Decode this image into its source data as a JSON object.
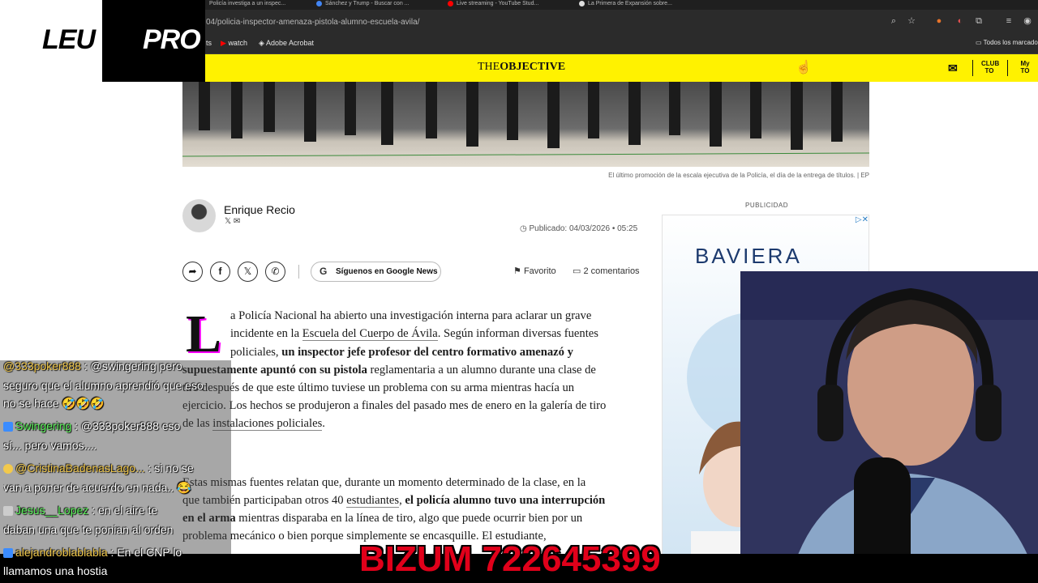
{
  "browser": {
    "tabs": [
      {
        "label": "Policía investiga a un inspec..."
      },
      {
        "label": "Sánchez y Trump - Buscar con ..."
      },
      {
        "label": "Live streaming - YouTube Stud..."
      },
      {
        "label": "La Primera de Expansión sobre..."
      }
    ],
    "url": "04/policia-inspector-amenaza-pistola-alumno-escuela-avila/",
    "bookmarks": [
      {
        "label": "ts"
      },
      {
        "label": "watch"
      },
      {
        "label": "Adobe Acrobat"
      }
    ],
    "bookmarks_right": "Todos los marcadores"
  },
  "site": {
    "logo_the": "THE",
    "logo_objective": "OBJECTIVE",
    "club_label": "CLUB TO",
    "my_label": "My TO",
    "accent_color": "#fff200"
  },
  "hero": {
    "caption": "El último promoción de la escala ejecutiva de la Policía, el día de la entrega de títulos. | EP"
  },
  "author": {
    "name": "Enrique Recio",
    "social": "𝕏 ✉",
    "published": "Publicado: 04/03/2026 • 05:25"
  },
  "share": {
    "google_news": "Síguenos en Google News",
    "favorito": "Favorito",
    "comentarios": "2 comentarios"
  },
  "article": {
    "dropcap": "L",
    "p1_a": "a Policía Nacional ha abierto una investigación interna para aclarar un grave",
    "p1_b_pre": "incidente en la ",
    "p1_b_link": "Escuela del Cuerpo de Ávila",
    "p1_b_post": ". Según informan diversas fuentes",
    "p1_c_pre": "policiales, ",
    "p1_c_bold": "un inspector jefe profesor del centro formativo amenazó y",
    "p1_d_bold": "supuestamente apuntó con su pistola",
    "p1_d_post": " reglamentaria a un alumno durante una clase de",
    "p1_e": "tiro después de que este último tuviese un problema con su arma mientras hacía un",
    "p1_f": "ejercicio. Los hechos se produjeron a finales del pasado mes de enero en la galería de tiro",
    "p1_g_pre": "de las ",
    "p1_g_link": "instalaciones policiales",
    "p1_g_post": ".",
    "p2_a": "Estas mismas fuentes relatan que, durante un momento determinado de la clase, en la",
    "p2_b_pre": "que también participaban otros 40 ",
    "p2_b_link": "estudiantes",
    "p2_b_mid": ", ",
    "p2_b_bold": "el policía alumno tuvo una interrupción",
    "p2_c_bold": "en el arma",
    "p2_c_post": " mientras disparaba en la línea de tiro, algo que puede ocurrir bien por un",
    "p2_d": "problema mecánico o bien porque simplemente se encasquille. El estudiante,"
  },
  "ad": {
    "label": "PUBLICIDAD",
    "brand": "BAVIERA",
    "adchoices": "▷✕"
  },
  "overlay": {
    "logo_left": "LEU",
    "logo_right": "PRO",
    "bizum": "BIZUM 722645399",
    "chat": [
      {
        "user": "@333poker888",
        "text": ": @swingering pero"
      },
      {
        "user": "",
        "text": "seguro que el alumno aprendió que eso"
      },
      {
        "user": "",
        "text": "no se hace 🤣🤣🤣"
      },
      {
        "user": "Swingering",
        "text": ": @333poker888 eso"
      },
      {
        "user": "",
        "text": "sí... pero vamos...."
      },
      {
        "user": "@CristinaBadenasLago...",
        "text": ": si no se"
      },
      {
        "user": "",
        "text": "van a poner de acuerdo en nada.. 😂"
      },
      {
        "user": "Jesus__Lopez",
        "text": ": en el aire te"
      },
      {
        "user": "",
        "text": "daban una que te ponian al orden"
      },
      {
        "user": "alejandroblablabla",
        "text": ": En el CNP lo"
      },
      {
        "user": "",
        "text": "llamamos una hostia"
      }
    ]
  }
}
